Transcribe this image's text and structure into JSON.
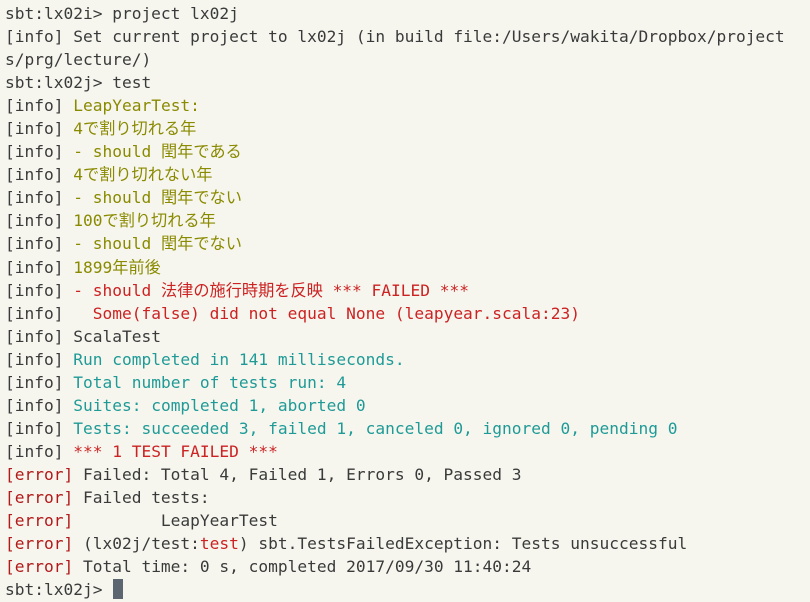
{
  "colors": {
    "background": "#f6f6ef",
    "text": "#3a3a3a",
    "success_yellow": "#8a8a00",
    "failure_red": "#cc2222",
    "summary_cyan": "#1f9a96",
    "error_tag": "#b31919",
    "cursor": "#5c6670"
  },
  "terminal": {
    "lines": [
      {
        "prefix": "",
        "text": "sbt:lx02i> project lx02j"
      },
      {
        "prefix": "[info] ",
        "text": "Set current project to lx02j (in build file:/Users/wakita/Dropbox/project"
      },
      {
        "prefix": "",
        "text": "s/prg/lecture/)"
      },
      {
        "prefix": "",
        "text": "sbt:lx02j> test"
      },
      {
        "prefix": "[info] ",
        "text": "LeapYearTest:"
      },
      {
        "prefix": "[info] ",
        "text": "4で割り切れる年"
      },
      {
        "prefix": "[info] ",
        "text": "- should 閏年である"
      },
      {
        "prefix": "[info] ",
        "text": "4で割り切れない年"
      },
      {
        "prefix": "[info] ",
        "text": "- should 閏年でない"
      },
      {
        "prefix": "[info] ",
        "text": "100で割り切れる年"
      },
      {
        "prefix": "[info] ",
        "text": "- should 閏年でない"
      },
      {
        "prefix": "[info] ",
        "text": "1899年前後"
      },
      {
        "prefix": "[info] ",
        "text": "- should 法律の施行時期を反映 *** FAILED ***"
      },
      {
        "prefix": "[info] ",
        "text": "  Some(false) did not equal None (leapyear.scala:23)"
      },
      {
        "prefix": "[info] ",
        "text": "ScalaTest"
      },
      {
        "prefix": "[info] ",
        "text": "Run completed in 141 milliseconds."
      },
      {
        "prefix": "[info] ",
        "text": "Total number of tests run: 4"
      },
      {
        "prefix": "[info] ",
        "text": "Suites: completed 1, aborted 0"
      },
      {
        "prefix": "[info] ",
        "text": "Tests: succeeded 3, failed 1, canceled 0, ignored 0, pending 0"
      },
      {
        "prefix": "[info] ",
        "text": "*** 1 TEST FAILED ***"
      },
      {
        "prefix": "[error] ",
        "text": "Failed: Total 4, Failed 1, Errors 0, Passed 3"
      },
      {
        "prefix": "[error] ",
        "text": "Failed tests:"
      },
      {
        "prefix": "[error] ",
        "text": "        LeapYearTest"
      },
      {
        "prefix": "[error] ",
        "text_a": "(lx02j/test:",
        "text_b": "test",
        "text_c": ") sbt.TestsFailedException: Tests unsuccessful"
      },
      {
        "prefix": "[error] ",
        "text": "Total time: 0 s, completed 2017/09/30 11:40:24"
      },
      {
        "prefix": "",
        "text": "sbt:lx02j> "
      }
    ]
  }
}
